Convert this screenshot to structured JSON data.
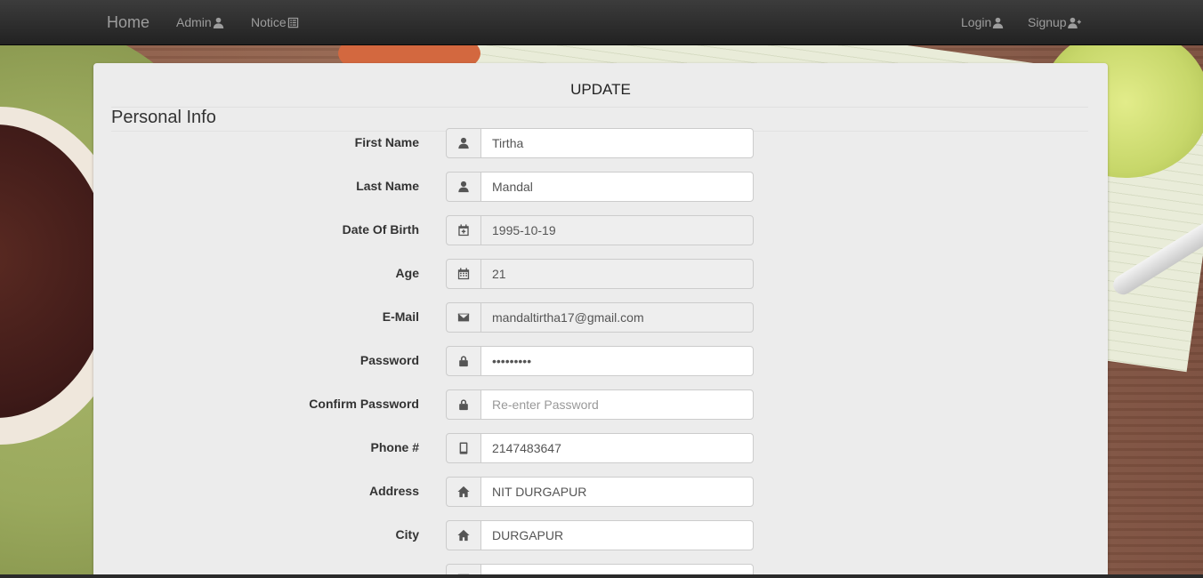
{
  "navbar": {
    "brand": "Home",
    "left_links": [
      {
        "label": "Admin",
        "icon": "user-icon"
      },
      {
        "label": "Notice",
        "icon": "list-icon"
      }
    ],
    "right_links": [
      {
        "label": "Login",
        "icon": "user-icon"
      },
      {
        "label": "Signup",
        "icon": "user-plus-icon"
      }
    ]
  },
  "form": {
    "title": "UPDATE",
    "section": "Personal Info",
    "fields": [
      {
        "label": "First Name",
        "icon": "user-icon",
        "value": "Tirtha",
        "placeholder": "",
        "readonly": false
      },
      {
        "label": "Last Name",
        "icon": "user-icon",
        "value": "Mandal",
        "placeholder": "",
        "readonly": false
      },
      {
        "label": "Date Of Birth",
        "icon": "calendar-plus-icon",
        "value": "1995-10-19",
        "placeholder": "",
        "readonly": true
      },
      {
        "label": "Age",
        "icon": "calendar-icon",
        "value": "21",
        "placeholder": "",
        "readonly": true
      },
      {
        "label": "E-Mail",
        "icon": "envelope-icon",
        "value": "mandaltirtha17@gmail.com",
        "placeholder": "",
        "readonly": true
      },
      {
        "label": "Password",
        "icon": "lock-icon",
        "value": "•••••••••",
        "placeholder": "",
        "readonly": false
      },
      {
        "label": "Confirm Password",
        "icon": "lock-icon",
        "value": "",
        "placeholder": "Re-enter Password",
        "readonly": false
      },
      {
        "label": "Phone #",
        "icon": "phone-icon",
        "value": "2147483647",
        "placeholder": "",
        "readonly": false
      },
      {
        "label": "Address",
        "icon": "home-icon",
        "value": "NIT DURGAPUR",
        "placeholder": "",
        "readonly": false
      },
      {
        "label": "City",
        "icon": "home-icon",
        "value": "DURGAPUR",
        "placeholder": "",
        "readonly": false
      }
    ]
  }
}
